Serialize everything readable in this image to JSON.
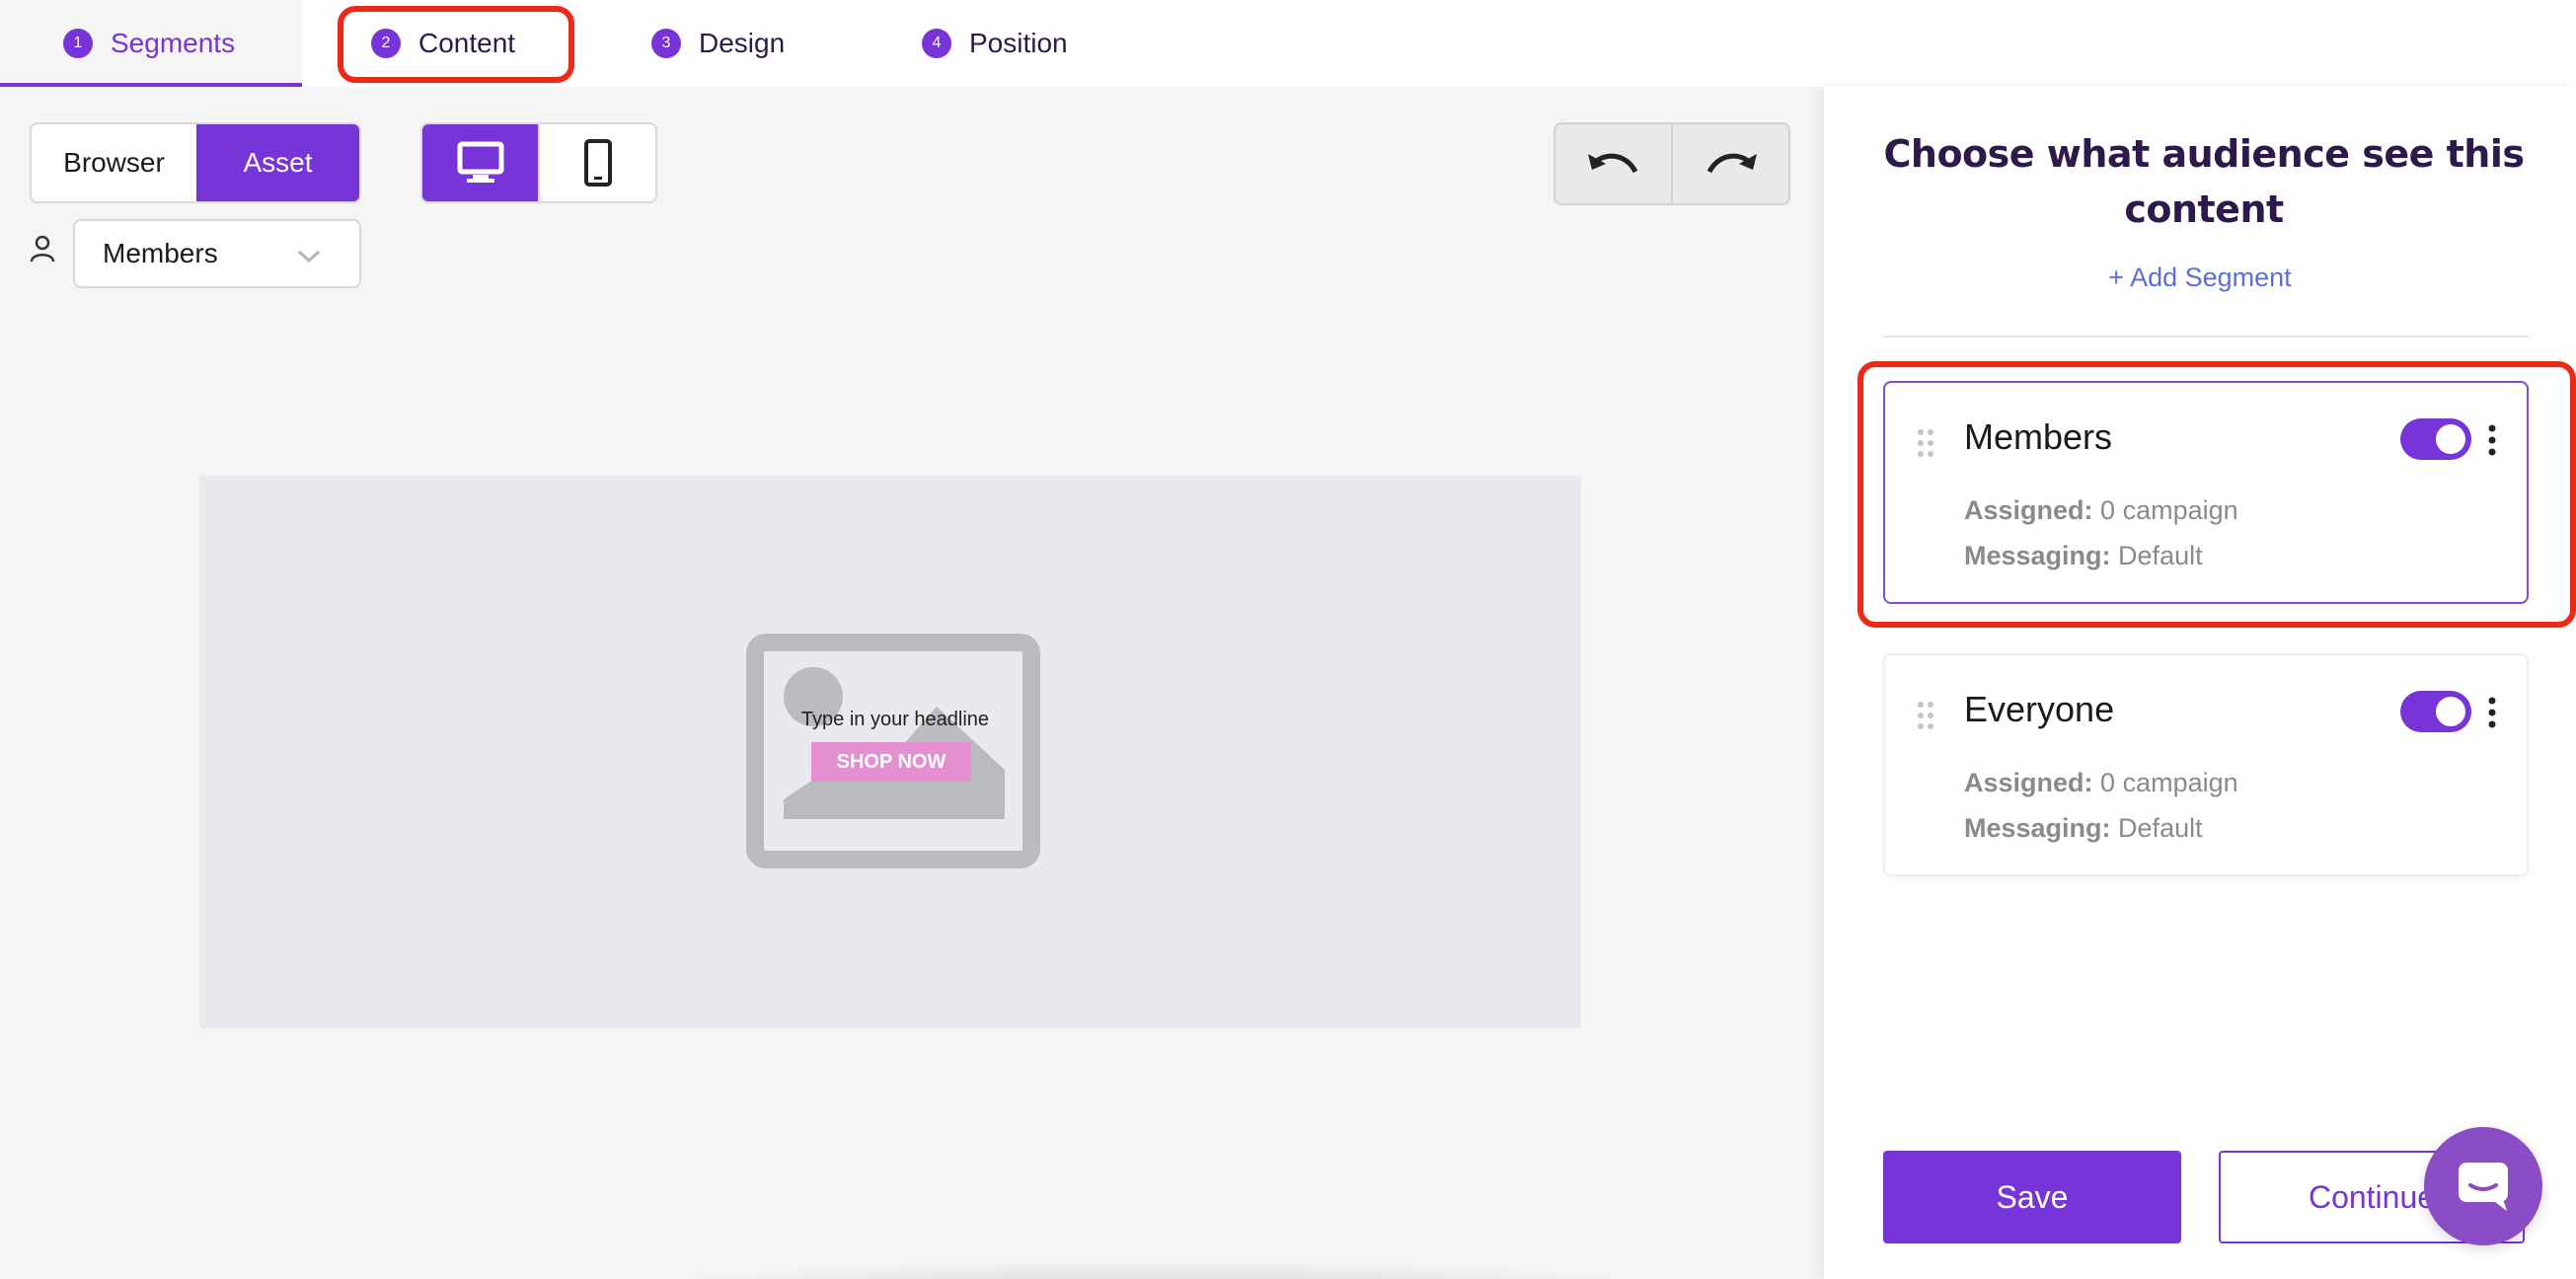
{
  "tabs": [
    {
      "num": "1",
      "label": "Segments"
    },
    {
      "num": "2",
      "label": "Content"
    },
    {
      "num": "3",
      "label": "Design"
    },
    {
      "num": "4",
      "label": "Position"
    }
  ],
  "toolbar": {
    "view_browser": "Browser",
    "view_asset": "Asset",
    "device_desktop_icon": "desktop-icon",
    "device_mobile_icon": "mobile-icon",
    "undo_icon": "undo-icon",
    "redo_icon": "redo-icon"
  },
  "audience_select": {
    "value": "Members"
  },
  "preview": {
    "headline": "Type in your headline",
    "button": "SHOP NOW"
  },
  "panel": {
    "title": "Choose what audience see this content",
    "add_segment": "+ Add Segment",
    "assigned_label": "Assigned:",
    "messaging_label": "Messaging:",
    "segments": [
      {
        "name": "Members",
        "assigned": "0 campaign",
        "messaging": "Default",
        "enabled": true
      },
      {
        "name": "Everyone",
        "assigned": "0 campaign",
        "messaging": "Default",
        "enabled": true
      }
    ],
    "save": "Save",
    "continue": "Continue"
  },
  "colors": {
    "accent": "#7634d9",
    "highlight": "#ec2a18",
    "link": "#5b6fd6"
  }
}
